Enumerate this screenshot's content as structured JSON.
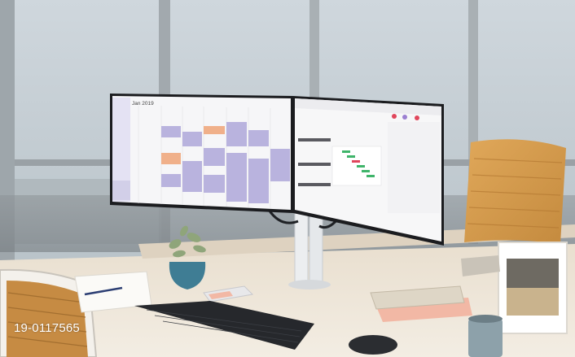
{
  "photo": {
    "caption": "19-0117565",
    "calendar": {
      "month_title": "Jan 2019"
    },
    "colors": {
      "wall": "#c9d2d8",
      "window_frame": "#9aa1a6",
      "desk_top": "#e8dccb",
      "desk_front": "#f2ebe0",
      "chair_orange": "#d49a4e",
      "calendar_purple": "#b9b3de",
      "calendar_orange": "#f0b08a",
      "monitor_bezel": "#1b1c1f",
      "keyboard": "#26282c",
      "planter_blue": "#3f7d94",
      "notebook_pink": "#f2b8a5"
    }
  }
}
